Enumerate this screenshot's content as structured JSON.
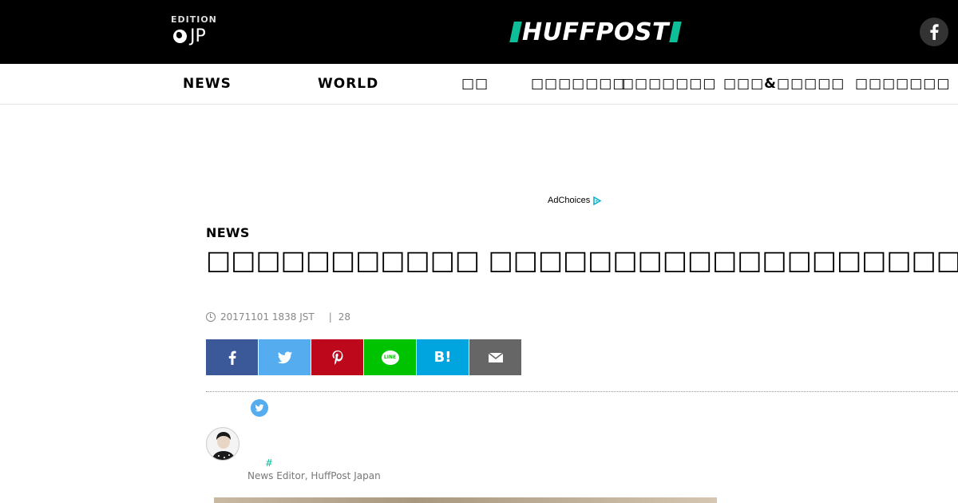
{
  "header": {
    "edition_label": "EDITION",
    "edition_value": "JP",
    "logo_text": "HUFFPOST",
    "brand_color": "#0dbe98"
  },
  "nav": {
    "items": [
      {
        "label": "NEWS"
      },
      {
        "label": "WORLD"
      },
      {
        "label": "□□"
      },
      {
        "label": "□□□□□□□"
      },
      {
        "label": "□□□□□□□"
      },
      {
        "label": "□□□&□□□□□"
      },
      {
        "label": "□□□□□□□"
      }
    ]
  },
  "ad": {
    "adchoices_label": "AdChoices"
  },
  "article": {
    "section": "NEWS",
    "headline": "□□□□□□□□□□□ □□□□□□□□□□□□□□□□□□□",
    "timestamp": "20171101 1838 JST",
    "separator": "|",
    "count": "28"
  },
  "share": {
    "hatena_label": "B!",
    "line_label": "LINE",
    "colors": {
      "facebook": "#3b5998",
      "twitter": "#55acee",
      "pinterest": "#bd081c",
      "line": "#00c300",
      "hatena": "#00a4de",
      "mail": "#666666"
    }
  },
  "author": {
    "hash": "#",
    "role": "News Editor, HuffPost Japan"
  }
}
